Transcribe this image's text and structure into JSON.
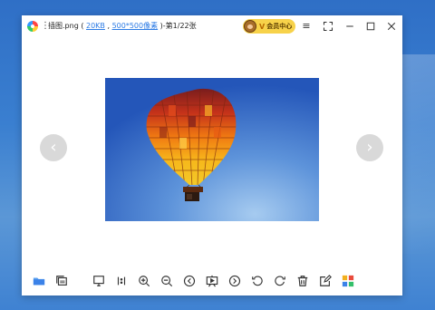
{
  "window": {
    "file_name": "插图.png",
    "paren_open": " ( ",
    "file_size": "20KB",
    "sep": " , ",
    "dimensions": "500*500像素",
    "index_text": " )-第1/22张"
  },
  "vip": {
    "v_glyph": "V",
    "label": "会员中心"
  },
  "titlebar_buttons": {
    "menu": "≡",
    "fullscreen": "⛶",
    "minimize": "—",
    "maximize": "☐",
    "close": "✕"
  },
  "nav": {
    "prev": "‹",
    "next": "›"
  },
  "colors": {
    "accent": "#2c7be5",
    "vip": "#f7d24a"
  },
  "toolbar": {
    "icons": [
      "folder-icon",
      "copy-icon",
      "monitor-icon",
      "original-size-icon",
      "zoom-in-icon",
      "zoom-out-icon",
      "previous-icon",
      "slideshow-icon",
      "next-icon",
      "rotate-left-icon",
      "rotate-right-icon",
      "delete-icon",
      "edit-icon",
      "apps-icon"
    ]
  }
}
